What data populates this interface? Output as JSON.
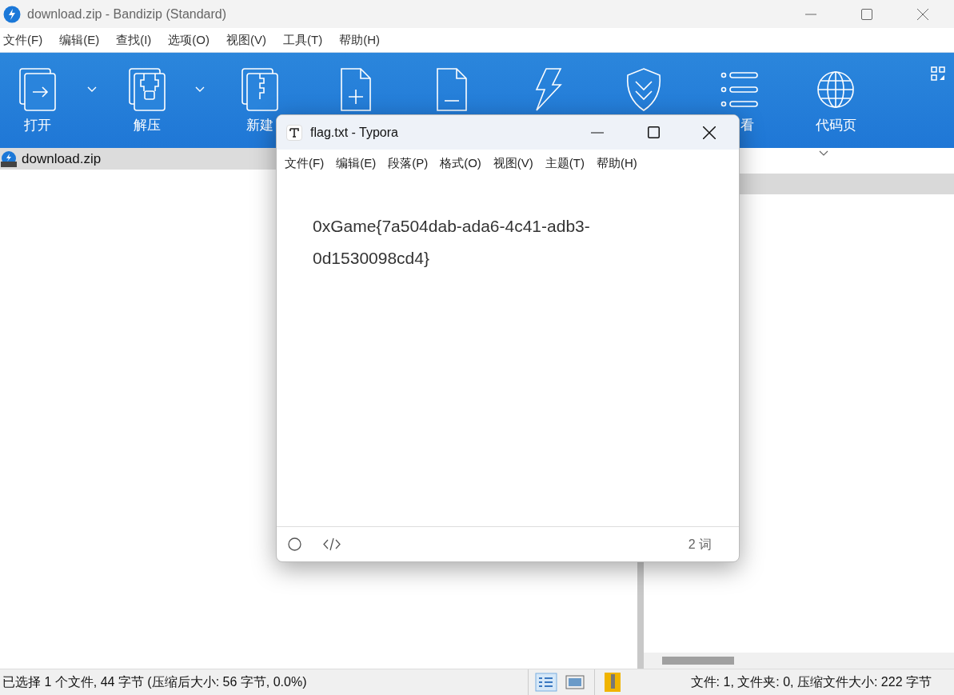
{
  "window": {
    "title": "download.zip - Bandizip (Standard)"
  },
  "menu": [
    "文件(F)",
    "编辑(E)",
    "查找(I)",
    "选项(O)",
    "视图(V)",
    "工具(T)",
    "帮助(H)"
  ],
  "toolbar": [
    {
      "kind": "open",
      "label": "打开",
      "dropdown": true
    },
    {
      "kind": "extract",
      "label": "解压",
      "dropdown": true
    },
    {
      "kind": "new",
      "label": "新建",
      "dropdown": false
    },
    {
      "kind": "add",
      "dropdown": false
    },
    {
      "kind": "remove",
      "dropdown": false
    },
    {
      "kind": "test",
      "dropdown": false
    },
    {
      "kind": "scan",
      "dropdown": false
    },
    {
      "kind": "view",
      "label": "看",
      "dropdown": false
    },
    {
      "kind": "codepage",
      "label": "代码页",
      "dropdown": true
    }
  ],
  "tree": {
    "items": [
      {
        "label": "download.zip",
        "selected": true
      }
    ]
  },
  "status_bar": {
    "left": "已选择 1 个文件, 44 字节 (压缩后大小: 56 字节, 0.0%)",
    "right": "文件: 1, 文件夹: 0, 压缩文件大小: 222 字节"
  },
  "typora": {
    "title": "flag.txt - Typora",
    "menu": [
      "文件(F)",
      "编辑(E)",
      "段落(P)",
      "格式(O)",
      "视图(V)",
      "主题(T)",
      "帮助(H)"
    ],
    "content": "0xGame{7a504dab-ada6-4c41-adb3-0d1530098cd4}",
    "word_count": "2 词"
  }
}
